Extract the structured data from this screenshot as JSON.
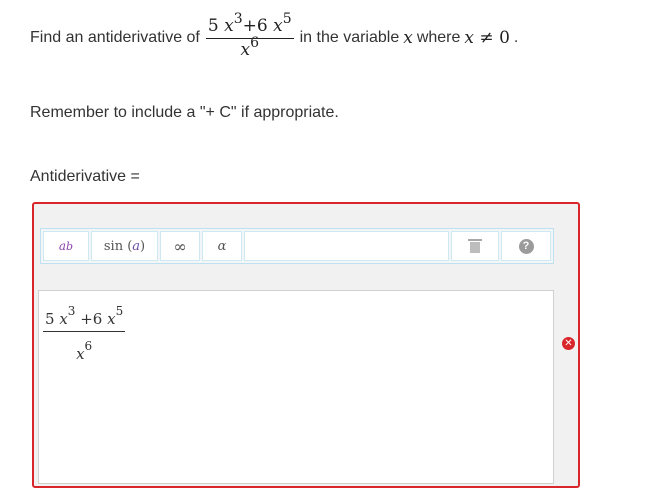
{
  "question": {
    "prefix": "Find an antiderivative of",
    "expr_numerator": {
      "coef1": "5",
      "var1": "x",
      "exp1": "3",
      "op": "+6",
      "var2": "x",
      "exp2": "5"
    },
    "expr_denominator": {
      "var": "x",
      "exp": "6"
    },
    "middle": "in the variable",
    "var": "x",
    "where": "where",
    "condition_var": "x",
    "condition_rel": "≠",
    "condition_value": "0",
    "period": "."
  },
  "reminder": "Remember to include a \"+ C\" if appropriate.",
  "answer_label": "Antiderivative =",
  "toolbar": {
    "power_base": "a",
    "power_exp": "b",
    "sin_label": "sin",
    "sin_open": "(",
    "sin_arg": "a",
    "sin_close": ")",
    "infinity": "∞",
    "alpha": "α",
    "trash_icon": "trash-icon",
    "help_icon": "help-icon",
    "help_glyph": "?"
  },
  "entry": {
    "numerator": {
      "coef1": "5",
      "var1": "x",
      "exp1": "3",
      "op": "+6",
      "var2": "x",
      "exp2": "5"
    },
    "denominator": {
      "var": "x",
      "exp": "6"
    }
  },
  "status": {
    "error_icon": "error-icon",
    "error_glyph": "✕",
    "color": "#d9262b"
  }
}
